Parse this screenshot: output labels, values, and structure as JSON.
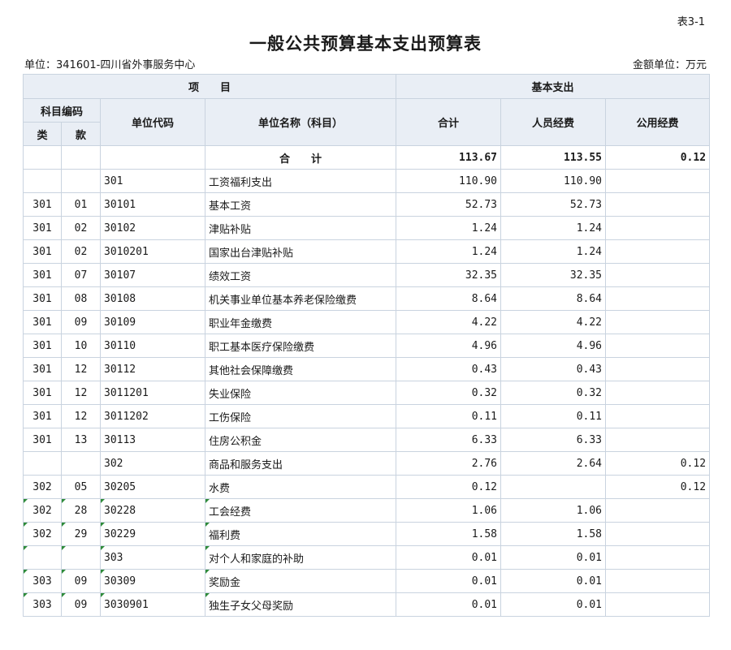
{
  "header": {
    "table_no": "表3-1",
    "title": "一般公共预算基本支出预算表",
    "unit_left": "单位：341601-四川省外事服务中心",
    "unit_right": "金额单位：万元"
  },
  "columns": {
    "xiangmu": "项　　目",
    "basic_expense": "基本支出",
    "km_code": "科目编码",
    "lei": "类",
    "kuan": "款",
    "unit_code": "单位代码",
    "unit_name": "单位名称（科目）",
    "total": "合计",
    "personnel": "人员经费",
    "public": "公用经费"
  },
  "total_row": {
    "name": "合　　计",
    "total": "113.67",
    "personnel": "113.55",
    "public": "0.12"
  },
  "rows": [
    {
      "lei": "",
      "kuan": "",
      "code": "301",
      "name": "工资福利支出",
      "total": "110.90",
      "personnel": "110.90",
      "public": "",
      "indent": false,
      "mark": false
    },
    {
      "lei": "301",
      "kuan": "01",
      "code": "30101",
      "name": "基本工资",
      "total": "52.73",
      "personnel": "52.73",
      "public": "",
      "indent": false,
      "mark": false
    },
    {
      "lei": "301",
      "kuan": "02",
      "code": "30102",
      "name": "津贴补贴",
      "total": "1.24",
      "personnel": "1.24",
      "public": "",
      "indent": false,
      "mark": false
    },
    {
      "lei": "301",
      "kuan": "02",
      "code": "3010201",
      "name": "国家出台津贴补贴",
      "total": "1.24",
      "personnel": "1.24",
      "public": "",
      "indent": true,
      "mark": false
    },
    {
      "lei": "301",
      "kuan": "07",
      "code": "30107",
      "name": "绩效工资",
      "total": "32.35",
      "personnel": "32.35",
      "public": "",
      "indent": false,
      "mark": false
    },
    {
      "lei": "301",
      "kuan": "08",
      "code": "30108",
      "name": "机关事业单位基本养老保险缴费",
      "total": "8.64",
      "personnel": "8.64",
      "public": "",
      "indent": false,
      "mark": false
    },
    {
      "lei": "301",
      "kuan": "09",
      "code": "30109",
      "name": "职业年金缴费",
      "total": "4.22",
      "personnel": "4.22",
      "public": "",
      "indent": false,
      "mark": false
    },
    {
      "lei": "301",
      "kuan": "10",
      "code": "30110",
      "name": "职工基本医疗保险缴费",
      "total": "4.96",
      "personnel": "4.96",
      "public": "",
      "indent": false,
      "mark": false
    },
    {
      "lei": "301",
      "kuan": "12",
      "code": "30112",
      "name": "其他社会保障缴费",
      "total": "0.43",
      "personnel": "0.43",
      "public": "",
      "indent": false,
      "mark": false
    },
    {
      "lei": "301",
      "kuan": "12",
      "code": "3011201",
      "name": "失业保险",
      "total": "0.32",
      "personnel": "0.32",
      "public": "",
      "indent": true,
      "mark": false
    },
    {
      "lei": "301",
      "kuan": "12",
      "code": "3011202",
      "name": "工伤保险",
      "total": "0.11",
      "personnel": "0.11",
      "public": "",
      "indent": true,
      "mark": false
    },
    {
      "lei": "301",
      "kuan": "13",
      "code": "30113",
      "name": "住房公积金",
      "total": "6.33",
      "personnel": "6.33",
      "public": "",
      "indent": false,
      "mark": false
    },
    {
      "lei": "",
      "kuan": "",
      "code": "302",
      "name": "商品和服务支出",
      "total": "2.76",
      "personnel": "2.64",
      "public": "0.12",
      "indent": false,
      "mark": false
    },
    {
      "lei": "302",
      "kuan": "05",
      "code": "30205",
      "name": "水费",
      "total": "0.12",
      "personnel": "",
      "public": "0.12",
      "indent": false,
      "mark": false
    },
    {
      "lei": "302",
      "kuan": "28",
      "code": "30228",
      "name": "工会经费",
      "total": "1.06",
      "personnel": "1.06",
      "public": "",
      "indent": false,
      "mark": true
    },
    {
      "lei": "302",
      "kuan": "29",
      "code": "30229",
      "name": "福利费",
      "total": "1.58",
      "personnel": "1.58",
      "public": "",
      "indent": false,
      "mark": true
    },
    {
      "lei": "",
      "kuan": "",
      "code": "303",
      "name": "对个人和家庭的补助",
      "total": "0.01",
      "personnel": "0.01",
      "public": "",
      "indent": false,
      "mark": true
    },
    {
      "lei": "303",
      "kuan": "09",
      "code": "30309",
      "name": "奖励金",
      "total": "0.01",
      "personnel": "0.01",
      "public": "",
      "indent": false,
      "mark": true
    },
    {
      "lei": "303",
      "kuan": "09",
      "code": "3030901",
      "name": "独生子女父母奖励",
      "total": "0.01",
      "personnel": "0.01",
      "public": "",
      "indent": true,
      "mark": true
    }
  ]
}
